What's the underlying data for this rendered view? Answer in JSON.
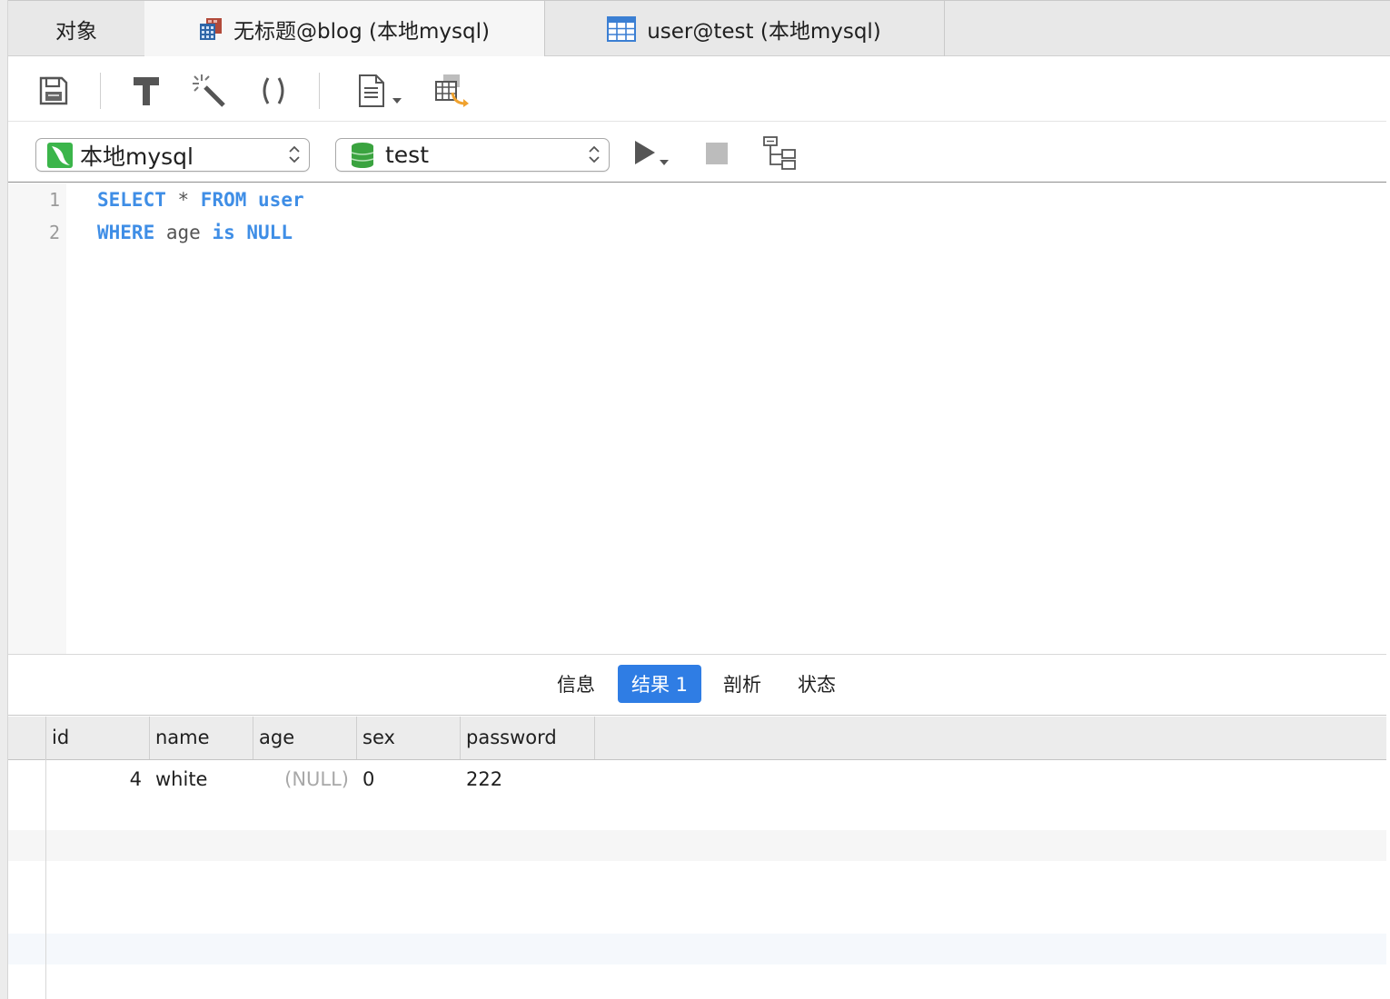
{
  "tabs": [
    {
      "label": "对象",
      "icon": null
    },
    {
      "label": "无标题@blog (本地mysql)",
      "icon": "query-icon"
    },
    {
      "label": "user@test (本地mysql)",
      "icon": "table-icon"
    }
  ],
  "toolbar": {
    "icons": [
      "save-icon",
      "format-icon",
      "beautify-icon",
      "parentheses-icon",
      "snippet-icon",
      "export-icon"
    ]
  },
  "connection_select": {
    "value": "本地mysql",
    "icon": "mysql-dolphin-icon"
  },
  "database_select": {
    "value": "test",
    "icon": "database-icon"
  },
  "run_controls": [
    "run-icon",
    "stop-icon",
    "explain-icon"
  ],
  "editor": {
    "lines": [
      {
        "number": "1",
        "tokens": [
          [
            "kw",
            "SELECT"
          ],
          [
            "plain",
            " * "
          ],
          [
            "kw",
            "FROM"
          ],
          [
            "plain",
            " "
          ],
          [
            "kw",
            "user"
          ]
        ]
      },
      {
        "number": "2",
        "tokens": [
          [
            "kw",
            "WHERE"
          ],
          [
            "plain",
            " age "
          ],
          [
            "kw",
            "is"
          ],
          [
            "plain",
            " "
          ],
          [
            "kw",
            "NULL"
          ]
        ]
      }
    ]
  },
  "result_tabs": [
    {
      "label": "信息",
      "active": false
    },
    {
      "label": "结果 1",
      "active": true
    },
    {
      "label": "剖析",
      "active": false
    },
    {
      "label": "状态",
      "active": false
    }
  ],
  "grid": {
    "columns": [
      "id",
      "name",
      "age",
      "sex",
      "password"
    ],
    "rows": [
      [
        "4",
        "white",
        "(NULL)",
        "0",
        "222"
      ]
    ]
  },
  "colors": {
    "accent": "#2f7de4",
    "keyword": "#3f8ee6",
    "null_text": "#a8a8a8"
  }
}
